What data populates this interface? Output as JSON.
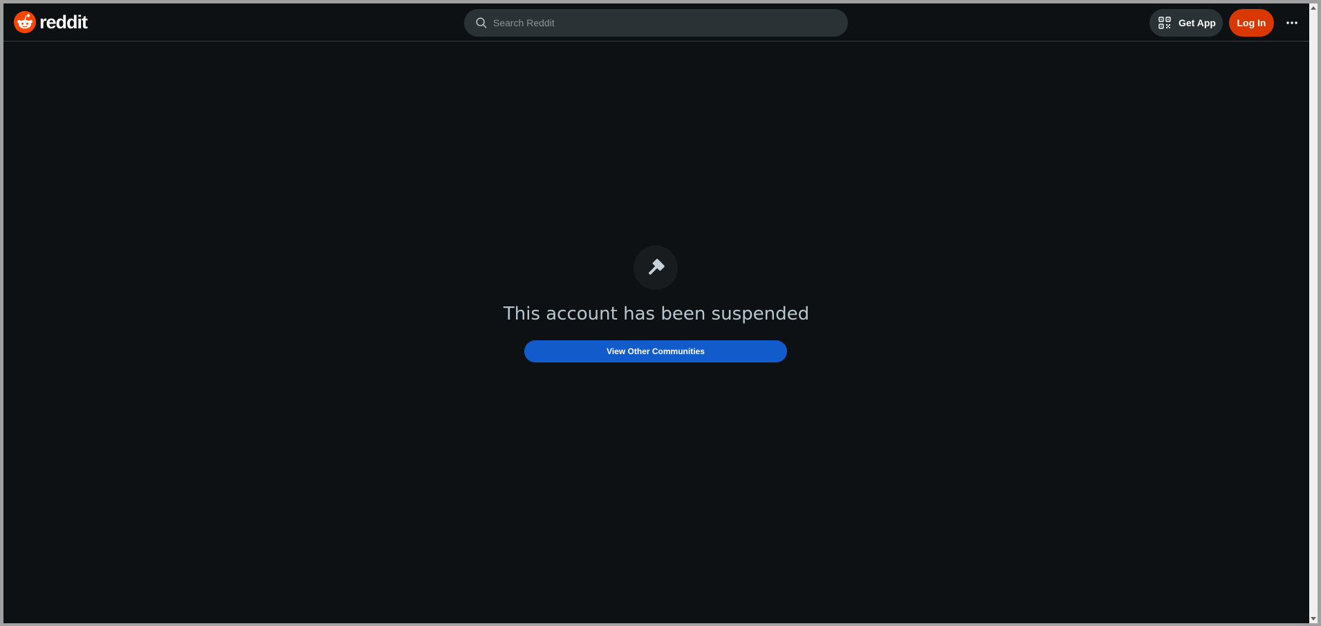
{
  "header": {
    "logo_text": "reddit",
    "logo_icon": "reddit-snoo-icon",
    "search": {
      "placeholder": "Search Reddit",
      "value": "",
      "icon": "search-icon"
    },
    "get_app": {
      "label": "Get App",
      "icon": "qr-code-icon"
    },
    "login_label": "Log In",
    "more_icon": "more-options-icon"
  },
  "main": {
    "icon": "gavel-icon",
    "title": "This account has been suspended",
    "cta_label": "View Other Communities"
  },
  "colors": {
    "background": "#0e1113",
    "header_border": "#3a3f43",
    "search_bg": "#2a3236",
    "brand_orange": "#d93900",
    "primary_blue": "#115bca",
    "title_text": "#b7c7d1"
  }
}
